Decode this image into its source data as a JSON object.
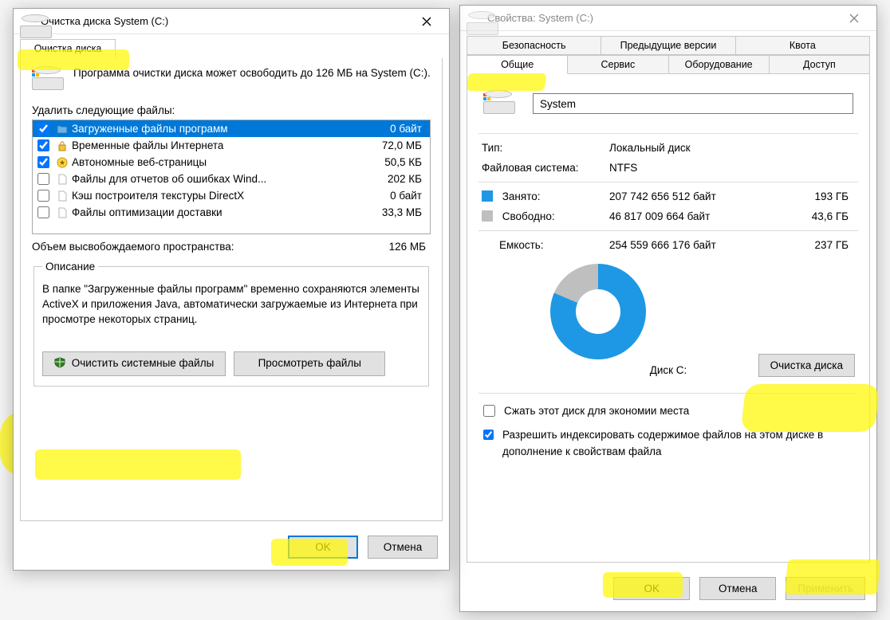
{
  "cleanup": {
    "title": "Очистка диска System (C:)",
    "tab_label": "Очистка диска",
    "intro": "Программа очистки диска может освободить до 126 МБ на System (C:).",
    "list_label": "Удалить следующие файлы:",
    "files": [
      {
        "checked": true,
        "icon": "folder",
        "name": "Загруженные файлы программ",
        "size": "0 байт",
        "selected": true
      },
      {
        "checked": true,
        "icon": "lock",
        "name": "Временные файлы Интернета",
        "size": "72,0 МБ"
      },
      {
        "checked": true,
        "icon": "star",
        "name": "Автономные веб-страницы",
        "size": "50,5 КБ"
      },
      {
        "checked": false,
        "icon": "page",
        "name": "Файлы для отчетов об ошибках Wind...",
        "size": "202 КБ"
      },
      {
        "checked": false,
        "icon": "page",
        "name": "Кэш построителя текстуры DirectX",
        "size": "0 байт"
      },
      {
        "checked": false,
        "icon": "page",
        "name": "Файлы оптимизации доставки",
        "size": "33,3 МБ"
      }
    ],
    "total_label": "Объем высвобождаемого пространства:",
    "total_value": "126 МБ",
    "desc_legend": "Описание",
    "desc_text": "В папке \"Загруженные файлы программ\" временно сохраняются элементы ActiveX и приложения Java, автоматически загружаемые из Интернета при просмотре некоторых страниц.",
    "btn_cleanup_system": "Очистить системные файлы",
    "btn_view": "Просмотреть файлы",
    "btn_ok": "OK",
    "btn_cancel": "Отмена"
  },
  "props": {
    "title": "Свойства: System (C:)",
    "tabs_top": [
      "Безопасность",
      "Предыдущие версии",
      "Квота"
    ],
    "tabs_bottom": [
      "Общие",
      "Сервис",
      "Оборудование",
      "Доступ"
    ],
    "active_tab": "Общие",
    "volume_name": "System",
    "rows": {
      "type_l": "Тип:",
      "type_v": "Локальный диск",
      "fs_l": "Файловая система:",
      "fs_v": "NTFS",
      "used_l": "Занято:",
      "used_b": "207 742 656 512 байт",
      "used_h": "193 ГБ",
      "free_l": "Свободно:",
      "free_b": "46 817 009 664 байт",
      "free_h": "43,6 ГБ",
      "cap_l": "Емкость:",
      "cap_b": "254 559 666 176 байт",
      "cap_h": "237 ГБ"
    },
    "disk_caption": "Диск C:",
    "btn_cleanup": "Очистка диска",
    "chk_compress": "Сжать этот диск для экономии места",
    "chk_index": "Разрешить индексировать содержимое файлов на этом диске в дополнение к свойствам файла",
    "btn_ok": "OK",
    "btn_cancel": "Отмена",
    "btn_apply": "Применить"
  },
  "chart_data": {
    "type": "pie",
    "title": "Диск C:",
    "series": [
      {
        "name": "Занято",
        "value": 207742656512,
        "human": "193 ГБ",
        "color": "#1e98e4"
      },
      {
        "name": "Свободно",
        "value": 46817009664,
        "human": "43,6 ГБ",
        "color": "#bfbfbf"
      }
    ],
    "total": {
      "label": "Емкость",
      "value": 254559666176,
      "human": "237 ГБ"
    }
  }
}
